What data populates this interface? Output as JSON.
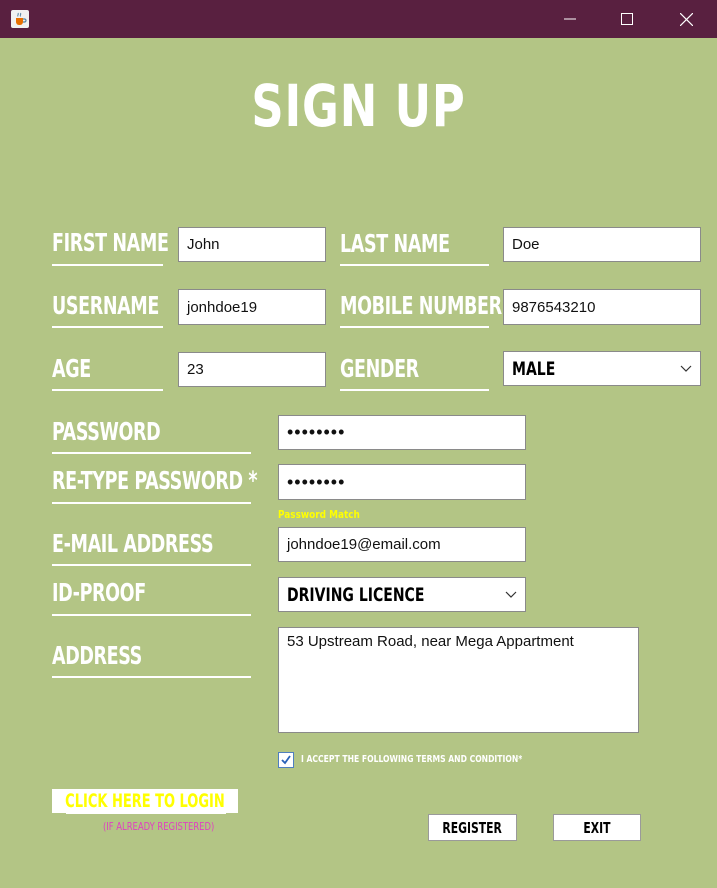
{
  "window": {
    "icon": "java-cup-icon",
    "controls": [
      "minimize-icon",
      "maximize-icon",
      "close-icon"
    ]
  },
  "heading": "SIGN UP",
  "form": {
    "first_name": {
      "label": "FIRST NAME",
      "value": "John"
    },
    "last_name": {
      "label": "LAST NAME",
      "value": "Doe"
    },
    "username": {
      "label": "USERNAME",
      "value": "jonhdoe19"
    },
    "mobile": {
      "label": "MOBILE NUMBER",
      "value": "9876543210"
    },
    "age": {
      "label": "AGE",
      "value": "23"
    },
    "gender": {
      "label": "GENDER",
      "selected": "MALE"
    },
    "password": {
      "label": "PASSWORD",
      "value": "••••••••"
    },
    "retype_password": {
      "label": "RE-TYPE PASSWORD *",
      "value": "••••••••",
      "hint": "Password Match"
    },
    "email": {
      "label": "E-MAIL ADDRESS",
      "value": "johndoe19@email.com"
    },
    "id_proof": {
      "label": "ID-PROOF",
      "selected": "DRIVING LICENCE"
    },
    "address": {
      "label": "ADDRESS",
      "value": "53 Upstream Road, near Mega Appartment"
    }
  },
  "terms": {
    "checked": true,
    "label": "I ACCEPT THE FOLLOWING TERMS AND CONDITION*"
  },
  "login": {
    "link": "CLICK HERE TO LOGIN",
    "note": "(IF ALREADY REGISTERED)"
  },
  "buttons": {
    "register": "REGISTER",
    "exit": "EXIT"
  },
  "colors": {
    "background": "#b3c585",
    "titlebar": "#592040",
    "hint": "#ffff00",
    "login_note": "#e040c0"
  }
}
